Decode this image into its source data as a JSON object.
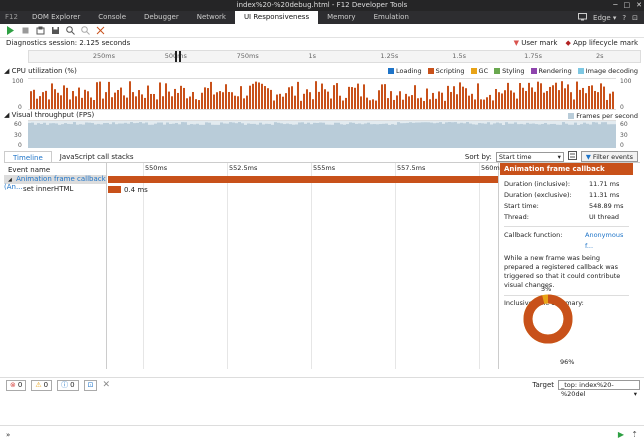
{
  "window": {
    "title": "index%20-%20debug.html - F12 Developer Tools",
    "min": "─",
    "max": "□",
    "close": "✕"
  },
  "tabs": [
    "DOM Explorer",
    "Console",
    "Debugger",
    "Network",
    "UI Responsiveness",
    "Memory",
    "Emulation"
  ],
  "f12_label": "F12",
  "active_tab": "UI Responsiveness",
  "browser_mode": "Edge",
  "session": {
    "label": "Diagnostics session: 2.125 seconds"
  },
  "marks": {
    "user_mark": "User mark",
    "app_lifecycle_mark": "App lifecycle mark"
  },
  "ruler_ticks": [
    "250ms",
    "500ms",
    "750ms",
    "1s",
    "1.25s",
    "1.5s",
    "1.75s",
    "2s"
  ],
  "cpu": {
    "title": "CPU utilization (%)",
    "axis_top": "100",
    "axis_bottom": "0",
    "legend": [
      {
        "name": "Loading",
        "color": "#1e74c8"
      },
      {
        "name": "Scripting",
        "color": "#c8511a"
      },
      {
        "name": "GC",
        "color": "#e8a317"
      },
      {
        "name": "Styling",
        "color": "#6aa84f"
      },
      {
        "name": "Rendering",
        "color": "#8e44ad"
      },
      {
        "name": "Image decoding",
        "color": "#7ec8e3"
      }
    ]
  },
  "fps": {
    "title": "Visual throughput (FPS)",
    "legend": "Frames per second",
    "axis": [
      "60",
      "30",
      "0"
    ],
    "color": "#b9ccd9"
  },
  "subtabs": [
    "Timeline",
    "JavaScript call stacks"
  ],
  "sort": {
    "label": "Sort by:",
    "value": "Start time"
  },
  "filter_button": "Filter events",
  "grid": {
    "column_header": "Event name",
    "ticks": [
      "550ms",
      "552.5ms",
      "555ms",
      "557.5ms",
      "560ms"
    ],
    "rows": [
      {
        "name": "Animation frame callback (An...",
        "toggle": "◢",
        "bar_color": "#c8511a"
      },
      {
        "name": "set innerHTML",
        "duration": "0.4 ms",
        "bar_color": "#c8511a"
      }
    ]
  },
  "details": {
    "header": "Animation frame callback",
    "fields": [
      {
        "k": "Duration (inclusive):",
        "v": "11.71 ms"
      },
      {
        "k": "Duration (exclusive):",
        "v": "11.31 ms"
      },
      {
        "k": "Start time:",
        "v": "548.89 ms"
      },
      {
        "k": "Thread:",
        "v": "UI thread"
      }
    ],
    "callback_label": "Callback function:",
    "callback_value": "Anonymous f...",
    "description": "While a new frame was being prepared a registered callback was triggered so that it could contribute visual changes.",
    "summary_label": "Inclusive time summary:",
    "pct_small": "3%",
    "pct_large": "96%",
    "donut": {
      "large_fraction": 0.96,
      "large_color": "#c8511a",
      "small_color": "#e8a317"
    }
  },
  "console": {
    "errors": "0",
    "warnings": "0",
    "info": "0",
    "target_label": "Target",
    "target_value": "_top: index%20-%20del"
  }
}
